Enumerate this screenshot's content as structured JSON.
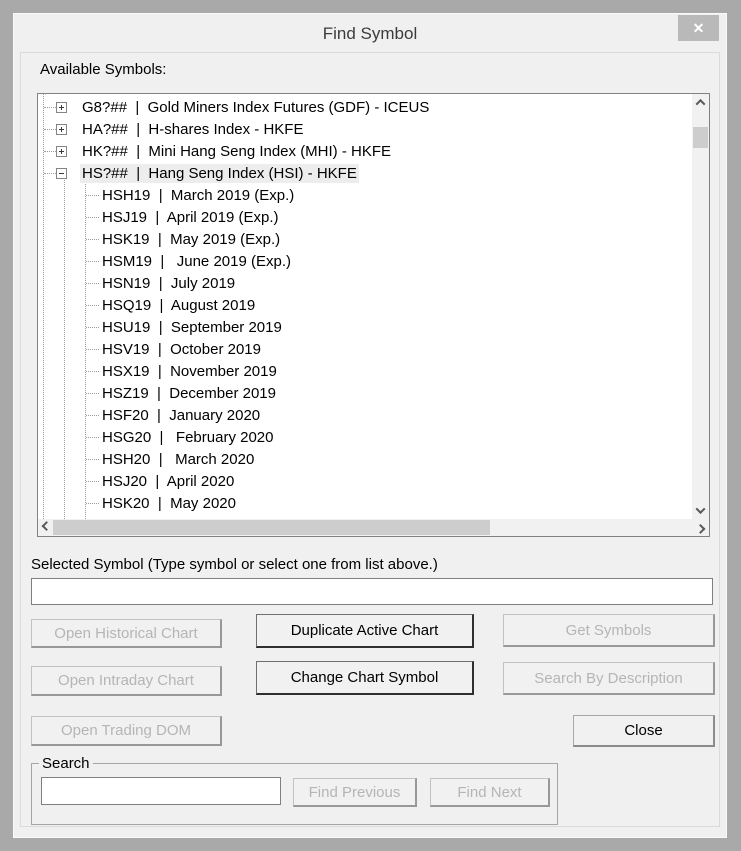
{
  "window": {
    "title": "Find Symbol",
    "close_glyph": "✕"
  },
  "available_symbols_label": "Available Symbols:",
  "tree": {
    "groups": [
      {
        "label": "G8?##  |  Gold Miners Index Futures (GDF) - ICEUS",
        "expanded": false,
        "selected": false,
        "children": []
      },
      {
        "label": "HA?##  |  H-shares Index - HKFE",
        "expanded": false,
        "selected": false,
        "children": []
      },
      {
        "label": "HK?##  |  Mini Hang Seng Index (MHI) - HKFE",
        "expanded": false,
        "selected": false,
        "children": []
      },
      {
        "label": "HS?##  |  Hang Seng Index (HSI) - HKFE",
        "expanded": true,
        "selected": true,
        "children": [
          "HSH19  |  March 2019 (Exp.)",
          "HSJ19  |  April 2019 (Exp.)",
          "HSK19  |  May 2019 (Exp.)",
          "HSM19  |   June 2019 (Exp.)",
          "HSN19  |  July 2019",
          "HSQ19  |  August 2019",
          "HSU19  |  September 2019",
          "HSV19  |  October 2019",
          "HSX19  |  November 2019",
          "HSZ19  |  December 2019",
          "HSF20  |  January 2020",
          "HSG20  |   February 2020",
          "HSH20  |   March 2020",
          "HSJ20  |  April 2020",
          "HSK20  |  May 2020"
        ]
      }
    ]
  },
  "selected_symbol": {
    "label": "Selected Symbol (Type symbol or select one from list above.)",
    "value": ""
  },
  "buttons": {
    "open_historical": "Open Historical Chart",
    "duplicate_active": "Duplicate Active Chart",
    "get_symbols": "Get Symbols",
    "open_intraday": "Open Intraday Chart",
    "change_chart": "Change Chart Symbol",
    "search_by_description": "Search By Description",
    "open_trading_dom": "Open Trading DOM",
    "close": "Close",
    "find_previous": "Find Previous",
    "find_next": "Find Next"
  },
  "search": {
    "group_label": "Search",
    "value": ""
  },
  "colors": {
    "page_bg": "#a9a9a9",
    "dialog_bg": "#f0f0f0",
    "close_button_bg": "#b9b9b9",
    "selection_bg": "#ededed",
    "disabled_text": "#b5b5b5",
    "scroll_thumb": "#cdcdcd"
  }
}
